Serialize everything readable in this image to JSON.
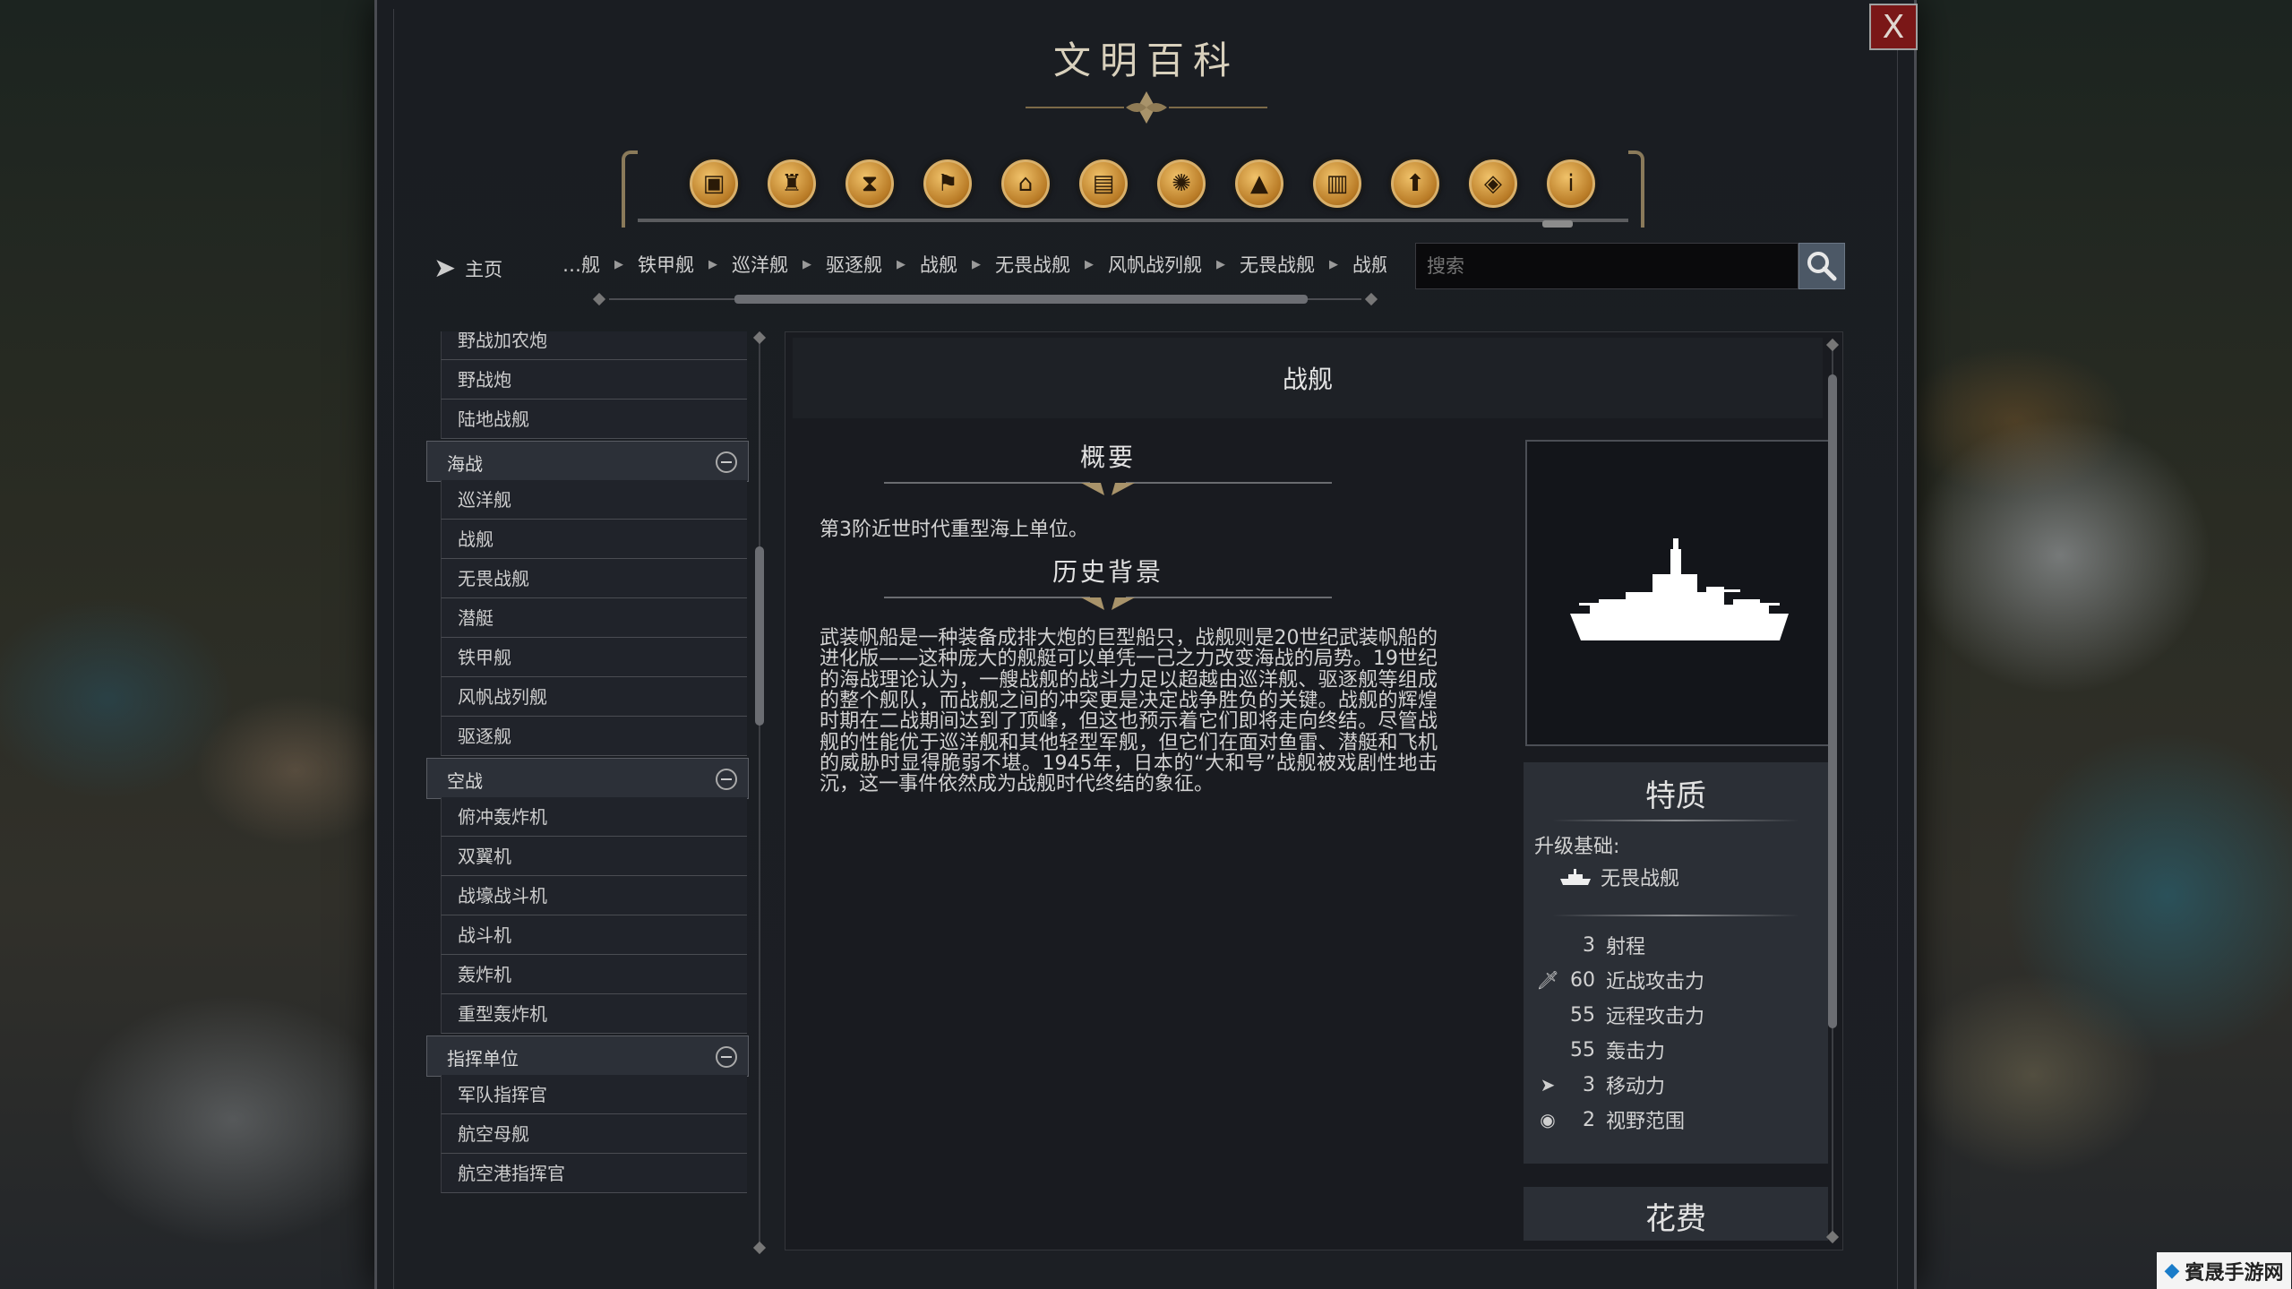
{
  "window": {
    "title": "文明百科",
    "close_label": "X"
  },
  "categories": [
    {
      "icon": "units-box-icon",
      "glyph": "▣"
    },
    {
      "icon": "civilization-icon",
      "glyph": "♜"
    },
    {
      "icon": "eras-hourglass-icon",
      "glyph": "⧗"
    },
    {
      "icon": "flag-icon",
      "glyph": "⚑"
    },
    {
      "icon": "government-icon",
      "glyph": "⌂"
    },
    {
      "icon": "book-icon",
      "glyph": "▤"
    },
    {
      "icon": "atom-icon",
      "glyph": "✺"
    },
    {
      "icon": "terrain-icon",
      "glyph": "▲"
    },
    {
      "icon": "buildings-icon",
      "glyph": "▥"
    },
    {
      "icon": "upgrade-arrow-icon",
      "glyph": "⬆"
    },
    {
      "icon": "resource-icon",
      "glyph": "◈"
    },
    {
      "icon": "info-icon",
      "glyph": "i"
    }
  ],
  "nav": {
    "home_label": "主页",
    "breadcrumbs": [
      "…舰",
      "铁甲舰",
      "巡洋舰",
      "驱逐舰",
      "战舰",
      "无畏战舰",
      "风帆战列舰",
      "无畏战舰",
      "战舰"
    ],
    "search_placeholder": "搜索"
  },
  "sidebar": {
    "items": [
      {
        "type": "item",
        "label": "野战加农炮"
      },
      {
        "type": "item",
        "label": "野战炮"
      },
      {
        "type": "item",
        "label": "陆地战舰"
      },
      {
        "type": "group",
        "label": "海战"
      },
      {
        "type": "item",
        "label": "巡洋舰"
      },
      {
        "type": "item",
        "label": "战舰"
      },
      {
        "type": "item",
        "label": "无畏战舰"
      },
      {
        "type": "item",
        "label": "潜艇"
      },
      {
        "type": "item",
        "label": "铁甲舰"
      },
      {
        "type": "item",
        "label": "风帆战列舰"
      },
      {
        "type": "item",
        "label": "驱逐舰"
      },
      {
        "type": "group",
        "label": "空战"
      },
      {
        "type": "item",
        "label": "俯冲轰炸机"
      },
      {
        "type": "item",
        "label": "双翼机"
      },
      {
        "type": "item",
        "label": "战壕战斗机"
      },
      {
        "type": "item",
        "label": "战斗机"
      },
      {
        "type": "item",
        "label": "轰炸机"
      },
      {
        "type": "item",
        "label": "重型轰炸机"
      },
      {
        "type": "group",
        "label": "指挥单位"
      },
      {
        "type": "item",
        "label": "军队指挥官"
      },
      {
        "type": "item",
        "label": "航空母舰"
      },
      {
        "type": "item",
        "label": "航空港指挥官"
      }
    ]
  },
  "article": {
    "title": "战舰",
    "summary_heading": "概要",
    "summary_text": "第3阶近世时代重型海上单位。",
    "history_heading": "历史背景",
    "history_text": "武装帆船是一种装备成排大炮的巨型船只，战舰则是20世纪武装帆船的进化版——这种庞大的舰艇可以单凭一己之力改变海战的局势。19世纪的海战理论认为，一艘战舰的战斗力足以超越由巡洋舰、驱逐舰等组成的整个舰队，而战舰之间的冲突更是决定战争胜负的关键。战舰的辉煌时期在二战期间达到了顶峰，但这也预示着它们即将走向终结。尽管战舰的性能优于巡洋舰和其他轻型军舰，但它们在面对鱼雷、潜艇和飞机的威胁时显得脆弱不堪。1945年，日本的“大和号”战舰被戏剧性地击沉，这一事件依然成为战舰时代终结的象征。"
  },
  "traits": {
    "title": "特质",
    "upgrade_label": "升级基础:",
    "upgrade_from": "无畏战舰",
    "stats": [
      {
        "icon": "",
        "value": "3",
        "label": "射程"
      },
      {
        "icon": "sword-icon",
        "value": "60",
        "label": "近战攻击力"
      },
      {
        "icon": "",
        "value": "55",
        "label": "远程攻击力"
      },
      {
        "icon": "",
        "value": "55",
        "label": "轰击力"
      },
      {
        "icon": "movement-arrow-icon",
        "value": "3",
        "label": "移动力"
      },
      {
        "icon": "eye-icon",
        "value": "2",
        "label": "视野范围"
      }
    ]
  },
  "cost": {
    "title": "花费"
  },
  "watermark": {
    "text": "賓晟手游网"
  }
}
